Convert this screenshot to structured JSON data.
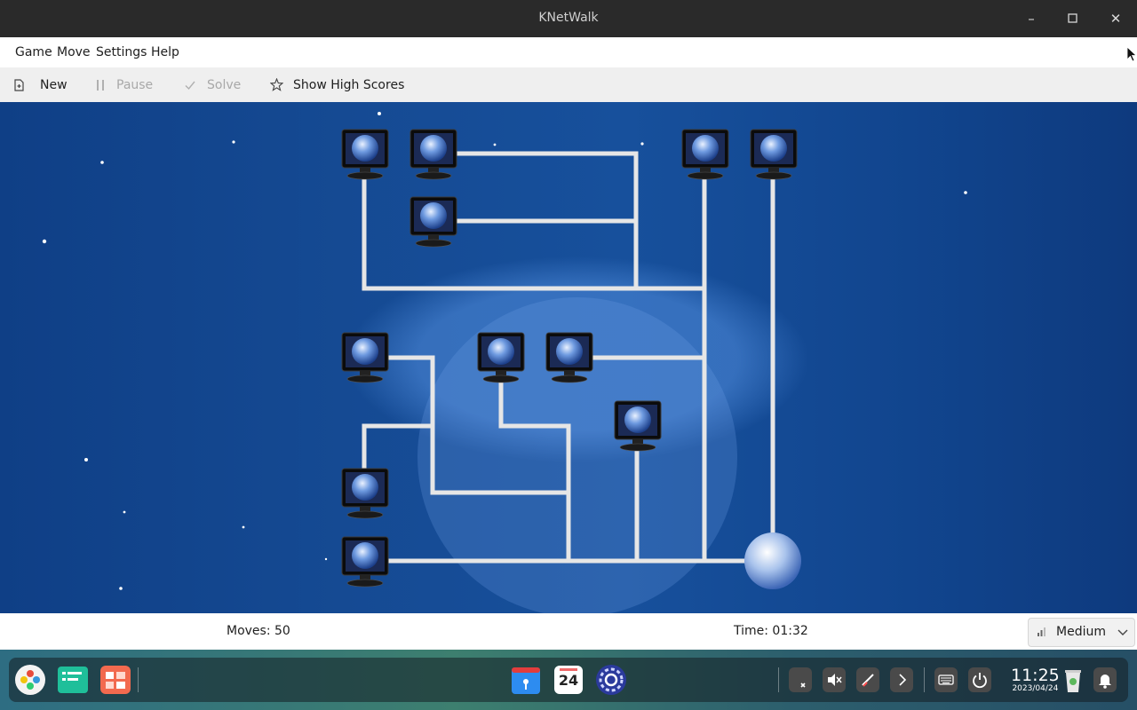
{
  "window": {
    "title": "KNetWalk"
  },
  "menu": [
    {
      "label": "Game"
    },
    {
      "label": "Move"
    },
    {
      "label": "Settings"
    },
    {
      "label": "Help"
    }
  ],
  "toolbar": {
    "new_label": "New",
    "pause_label": "Pause",
    "solve_label": "Solve",
    "highscores_label": "Show High Scores"
  },
  "status": {
    "moves": "Moves: 50",
    "time": "Time: 01:32",
    "difficulty": "Medium"
  },
  "taskbar": {
    "calendar_day": "24",
    "clock_time": "11:25",
    "clock_date": "2023/04/24"
  },
  "colors": {
    "game_background": "#154a93",
    "cable": "#e8e8e8",
    "titlebar": "#2a2a2a"
  }
}
